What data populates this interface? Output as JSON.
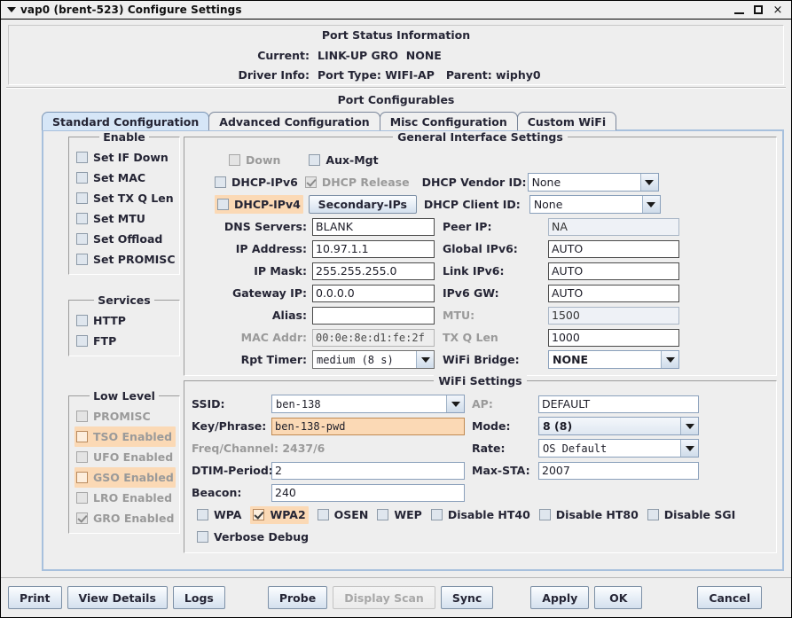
{
  "window": {
    "title": "vap0  (brent-523) Configure Settings",
    "minimize_label": "minimize-icon",
    "maximize_label": "maximize-icon",
    "close_label": "×"
  },
  "status": {
    "title": "Port Status Information",
    "rows": [
      {
        "label": "Current:",
        "value": "LINK-UP GRO  NONE"
      },
      {
        "label": "Driver Info:",
        "value": "Port Type: WIFI-AP   Parent: wiphy0"
      }
    ]
  },
  "configurables": {
    "title": "Port Configurables",
    "tabs": [
      {
        "label": "Standard Configuration",
        "active": true
      },
      {
        "label": "Advanced Configuration",
        "active": false
      },
      {
        "label": "Misc Configuration",
        "active": false
      },
      {
        "label": "Custom WiFi",
        "active": false
      }
    ]
  },
  "enable_group": {
    "title": "Enable",
    "items": [
      {
        "label": "Set IF Down",
        "checked": false
      },
      {
        "label": "Set MAC",
        "checked": false
      },
      {
        "label": "Set TX Q Len",
        "checked": false
      },
      {
        "label": "Set MTU",
        "checked": false
      },
      {
        "label": "Set Offload",
        "checked": false
      },
      {
        "label": "Set PROMISC",
        "checked": false
      }
    ]
  },
  "services_group": {
    "title": "Services",
    "items": [
      {
        "label": "HTTP",
        "checked": false
      },
      {
        "label": "FTP",
        "checked": false
      }
    ]
  },
  "lowlevel_group": {
    "title": "Low Level",
    "items": [
      {
        "label": "PROMISC",
        "checked": false,
        "highlight": false
      },
      {
        "label": "TSO Enabled",
        "checked": false,
        "highlight": true
      },
      {
        "label": "UFO Enabled",
        "checked": false,
        "highlight": false
      },
      {
        "label": "GSO Enabled",
        "checked": false,
        "highlight": true
      },
      {
        "label": "LRO Enabled",
        "checked": false,
        "highlight": false
      },
      {
        "label": "GRO Enabled",
        "checked": true,
        "highlight": false
      }
    ]
  },
  "general": {
    "title": "General Interface Settings",
    "down_label": "Down",
    "down_checked": false,
    "auxmgt_label": "Aux-Mgt",
    "auxmgt_checked": false,
    "dhcp_ipv6_label": "DHCP-IPv6",
    "dhcp_ipv6_checked": false,
    "dhcp_release_label": "DHCP Release",
    "dhcp_release_checked": true,
    "dhcp_ipv4_label": "DHCP-IPv4",
    "dhcp_ipv4_checked": false,
    "secondary_ips_label": "Secondary-IPs",
    "dhcp_vendor_id_label": "DHCP Vendor ID:",
    "dhcp_vendor_id_value": "None",
    "dhcp_client_id_label": "DHCP Client ID:",
    "dhcp_client_id_value": "None",
    "dns_servers_label": "DNS Servers:",
    "dns_servers_value": "BLANK",
    "peer_ip_label": "Peer IP:",
    "peer_ip_value": "NA",
    "ip_address_label": "IP Address:",
    "ip_address_value": "10.97.1.1",
    "global_ipv6_label": "Global IPv6:",
    "global_ipv6_value": "AUTO",
    "ip_mask_label": "IP Mask:",
    "ip_mask_value": "255.255.255.0",
    "link_ipv6_label": "Link IPv6:",
    "link_ipv6_value": "AUTO",
    "gateway_ip_label": "Gateway IP:",
    "gateway_ip_value": "0.0.0.0",
    "ipv6_gw_label": "IPv6 GW:",
    "ipv6_gw_value": "AUTO",
    "alias_label": "Alias:",
    "alias_value": "",
    "mtu_label": "MTU:",
    "mtu_value": "1500",
    "mac_addr_label": "MAC Addr:",
    "mac_addr_value": "00:0e:8e:d1:fe:2f",
    "tx_q_len_label": "TX Q Len",
    "tx_q_len_value": "1000",
    "rpt_timer_label": "Rpt Timer:",
    "rpt_timer_value": "medium  (8 s)",
    "wifi_bridge_label": "WiFi Bridge:",
    "wifi_bridge_value": "NONE"
  },
  "wifi": {
    "title": "WiFi Settings",
    "ssid_label": "SSID:",
    "ssid_value": "ben-138",
    "ap_label": "AP:",
    "ap_value": "DEFAULT",
    "key_label": "Key/Phrase:",
    "key_value": "ben-138-pwd",
    "mode_label": "Mode:",
    "mode_value": "8 (8)",
    "freq_label": "Freq/Channel: 2437/6",
    "rate_label": "Rate:",
    "rate_value": "OS Default",
    "dtim_label": "DTIM-Period:",
    "dtim_value": "2",
    "maxsta_label": "Max-STA:",
    "maxsta_value": "2007",
    "beacon_label": "Beacon:",
    "beacon_value": "240",
    "flags": [
      {
        "label": "WPA",
        "checked": false,
        "highlight": false
      },
      {
        "label": "WPA2",
        "checked": true,
        "highlight": true
      },
      {
        "label": "OSEN",
        "checked": false,
        "highlight": false
      },
      {
        "label": "WEP",
        "checked": false,
        "highlight": false
      },
      {
        "label": "Disable HT40",
        "checked": false,
        "highlight": false
      },
      {
        "label": "Disable HT80",
        "checked": false,
        "highlight": false
      },
      {
        "label": "Disable SGI",
        "checked": false,
        "highlight": false
      }
    ],
    "verbose_label": "Verbose Debug",
    "verbose_checked": false
  },
  "buttons": {
    "print": "Print",
    "view_details": "View Details",
    "logs": "Logs",
    "probe": "Probe",
    "display_scan": "Display Scan",
    "sync": "Sync",
    "apply": "Apply",
    "ok": "OK",
    "cancel": "Cancel"
  },
  "colors": {
    "highlight": "#fbd9b5",
    "tab_active": "#d6e6f7",
    "panel_border": "#a7c0dd"
  }
}
